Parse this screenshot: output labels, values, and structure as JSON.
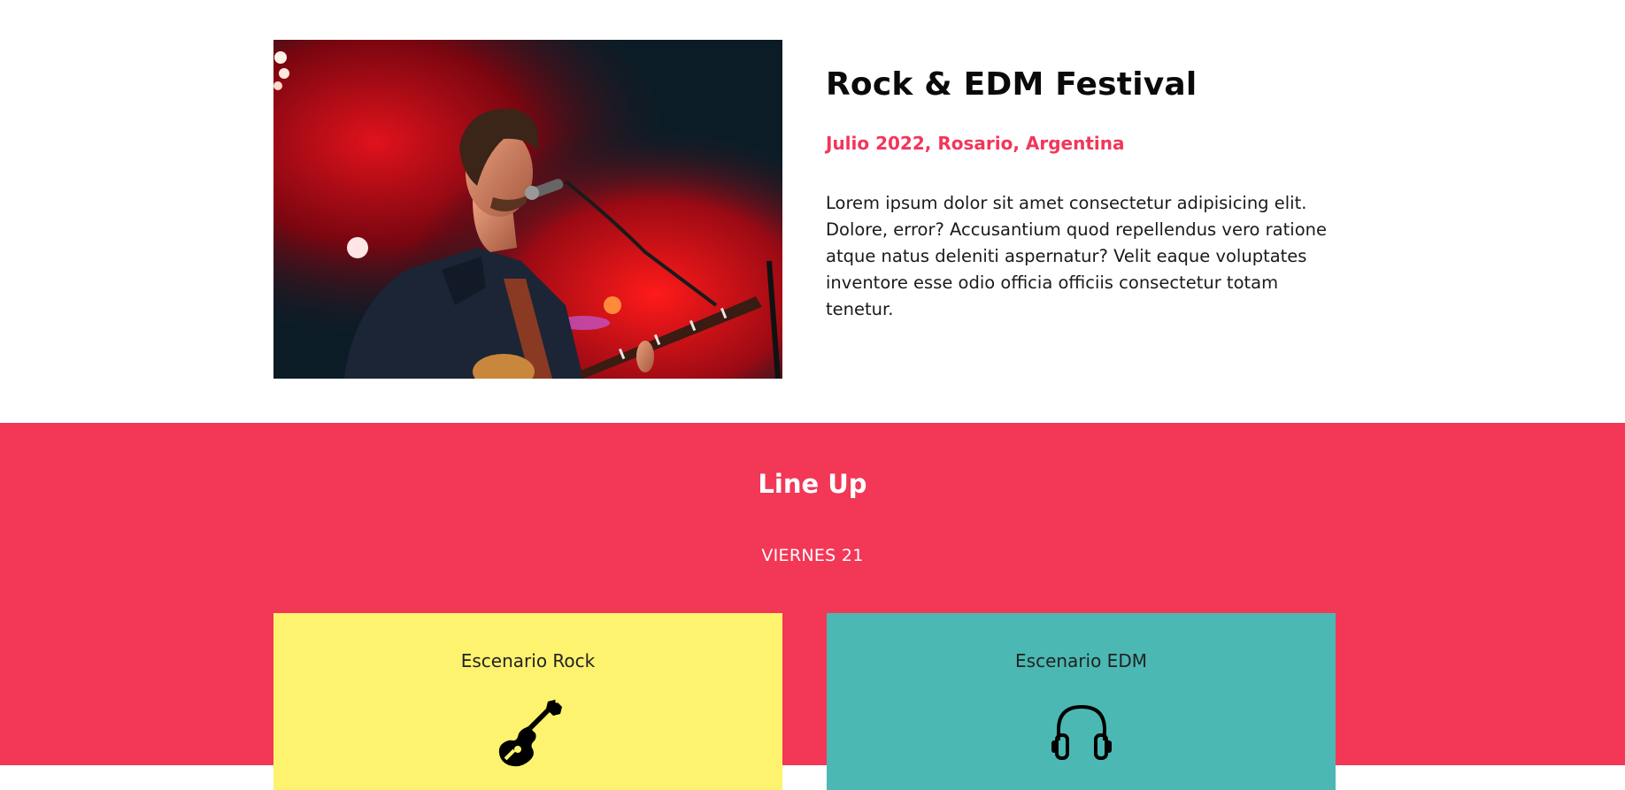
{
  "event": {
    "title": "Rock & EDM Festival",
    "date_location": "Julio 2022, Rosario, Argentina",
    "description": "Lorem ipsum dolor sit amet consectetur adipisicing elit. Dolore, error? Accusantium quod repellendus vero ratione atque natus deleniti aspernatur? Velit eaque voluptates inventore esse odio officia officiis consectetur totam tenetur."
  },
  "lineup": {
    "title": "Line Up",
    "day": "VIERNES 21",
    "stages": [
      {
        "name": "Escenario Rock",
        "icon": "guitar-icon",
        "color": "#fdf36e"
      },
      {
        "name": "Escenario EDM",
        "icon": "headphones-icon",
        "color": "#4bb8b3"
      }
    ]
  },
  "colors": {
    "accent": "#f33756",
    "date_text": "#f2365a"
  }
}
